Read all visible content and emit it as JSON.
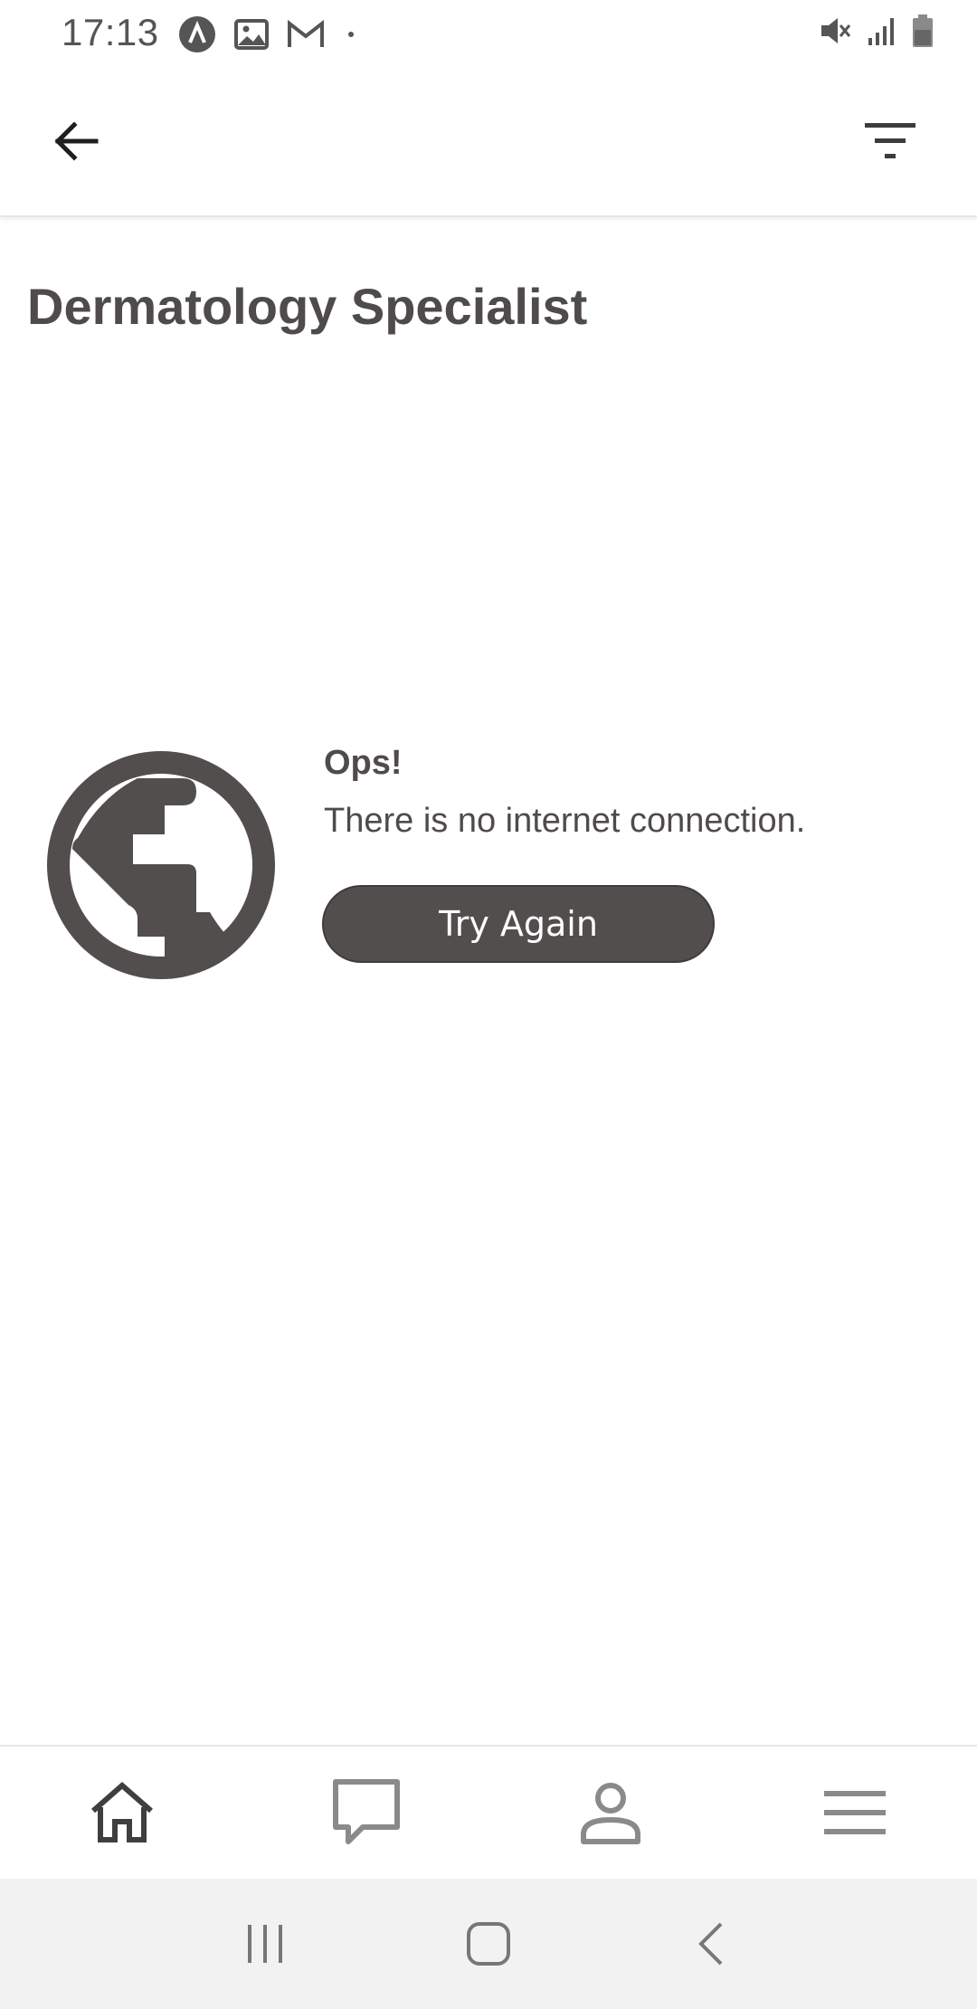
{
  "status_bar": {
    "time": "17:13",
    "left_icons": [
      "notification-a-icon",
      "gallery-icon",
      "gmail-icon",
      "dot-icon"
    ],
    "right_icons": [
      "mute-icon",
      "signal-icon",
      "battery-icon"
    ]
  },
  "app_bar": {
    "back_icon": "arrow-left-icon",
    "filter_icon": "filter-icon"
  },
  "page": {
    "title": "Dermatology Specialist"
  },
  "offline": {
    "icon": "globe-icon",
    "heading": "Ops!",
    "message": "There is no internet connection.",
    "retry_label": "Try Again"
  },
  "bottom_nav": {
    "items": [
      "home-icon",
      "chat-icon",
      "profile-icon",
      "menu-icon"
    ]
  },
  "system_nav": {
    "items": [
      "recents-icon",
      "home-button-icon",
      "back-chevron-icon"
    ]
  },
  "colors": {
    "primary_dark": "#524e4d",
    "text": "#4f4b4a",
    "nav_icon": "#808080",
    "system_bar": "#f2f2f2"
  }
}
